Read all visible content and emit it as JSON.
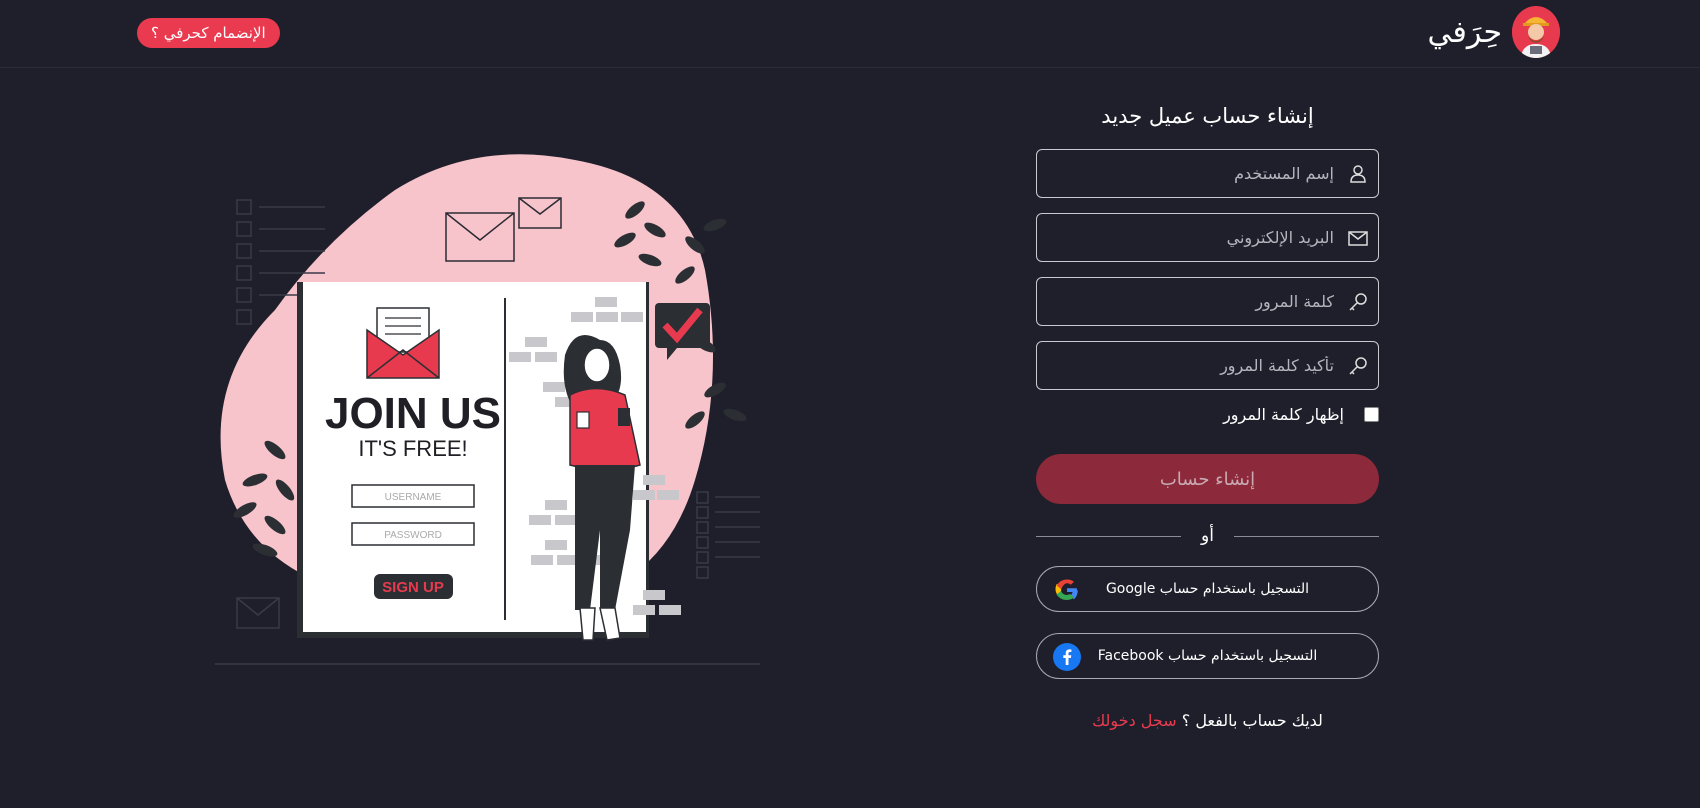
{
  "header": {
    "brand_name": "حِرَفي",
    "join_label": "الإنضمام كحرفي ؟"
  },
  "illustration": {
    "heading": "JOIN US",
    "subheading": "IT'S FREE!",
    "username_field": "USERNAME",
    "password_field": "PASSWORD",
    "signup_button": "SIGN UP"
  },
  "form": {
    "title": "إنشاء حساب عميل جديد",
    "username_placeholder": "إسم المستخدم",
    "email_placeholder": "البريد الإلكتروني",
    "password_placeholder": "كلمة المرور",
    "confirm_placeholder": "تأكيد كلمة المرور",
    "show_password_label": "إظهار كلمة المرور",
    "submit_label": "إنشاء حساب",
    "or_label": "أو",
    "google_label": "التسجيل باستخدام حساب Google",
    "facebook_label": "التسجيل باستخدام حساب Facebook",
    "have_account": "لديك حساب بالفعل ؟",
    "login_label": "سجل دخولك"
  },
  "colors": {
    "background": "#1f1f2b",
    "accent": "#ea3a4f",
    "submit_bg": "#8c2a3b",
    "blob": "#f8c4cc"
  }
}
